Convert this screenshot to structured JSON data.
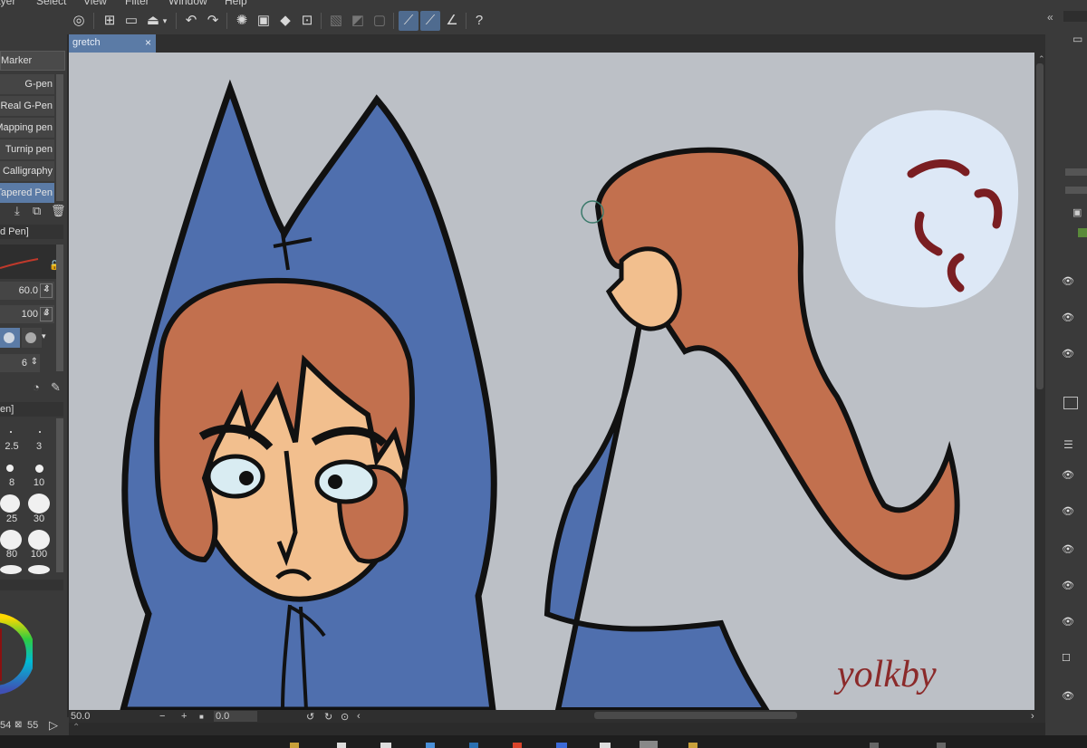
{
  "menu": [
    "ayer",
    "Select",
    "View",
    "Filter",
    "Window",
    "Help"
  ],
  "document": {
    "tab_name": "gretch",
    "close_symbol": "×"
  },
  "brush_panel": {
    "group": "Marker",
    "items": [
      "G-pen",
      "Real G-Pen",
      "Mapping pen",
      "Turnip pen",
      "Calligraphy",
      "Tapered Pen"
    ],
    "selected_index": 5,
    "tool_property_title": "d Pen]",
    "brush_size": "60.0",
    "opacity": "100",
    "anti_alias": "6",
    "size_panel_title": "en]",
    "sizes": [
      "2.5",
      "3",
      "8",
      "10",
      "25",
      "30",
      "80",
      "100"
    ]
  },
  "status": {
    "zoom": "50.0",
    "rotation": "0.0",
    "left_value_1": "54",
    "left_value_2": "55"
  },
  "artwork": {
    "signature": "yolkby",
    "colors": {
      "background": "#bcc0c6",
      "hood_blue": "#4f6fae",
      "hair": "#c2704e",
      "skin": "#f2bf8e",
      "bubble": "#dde8f6",
      "anger_mark": "#7a1e22",
      "outline": "#111111"
    }
  },
  "colors": {
    "accent": "#5b7ba6",
    "panel": "#3a3a3a"
  }
}
